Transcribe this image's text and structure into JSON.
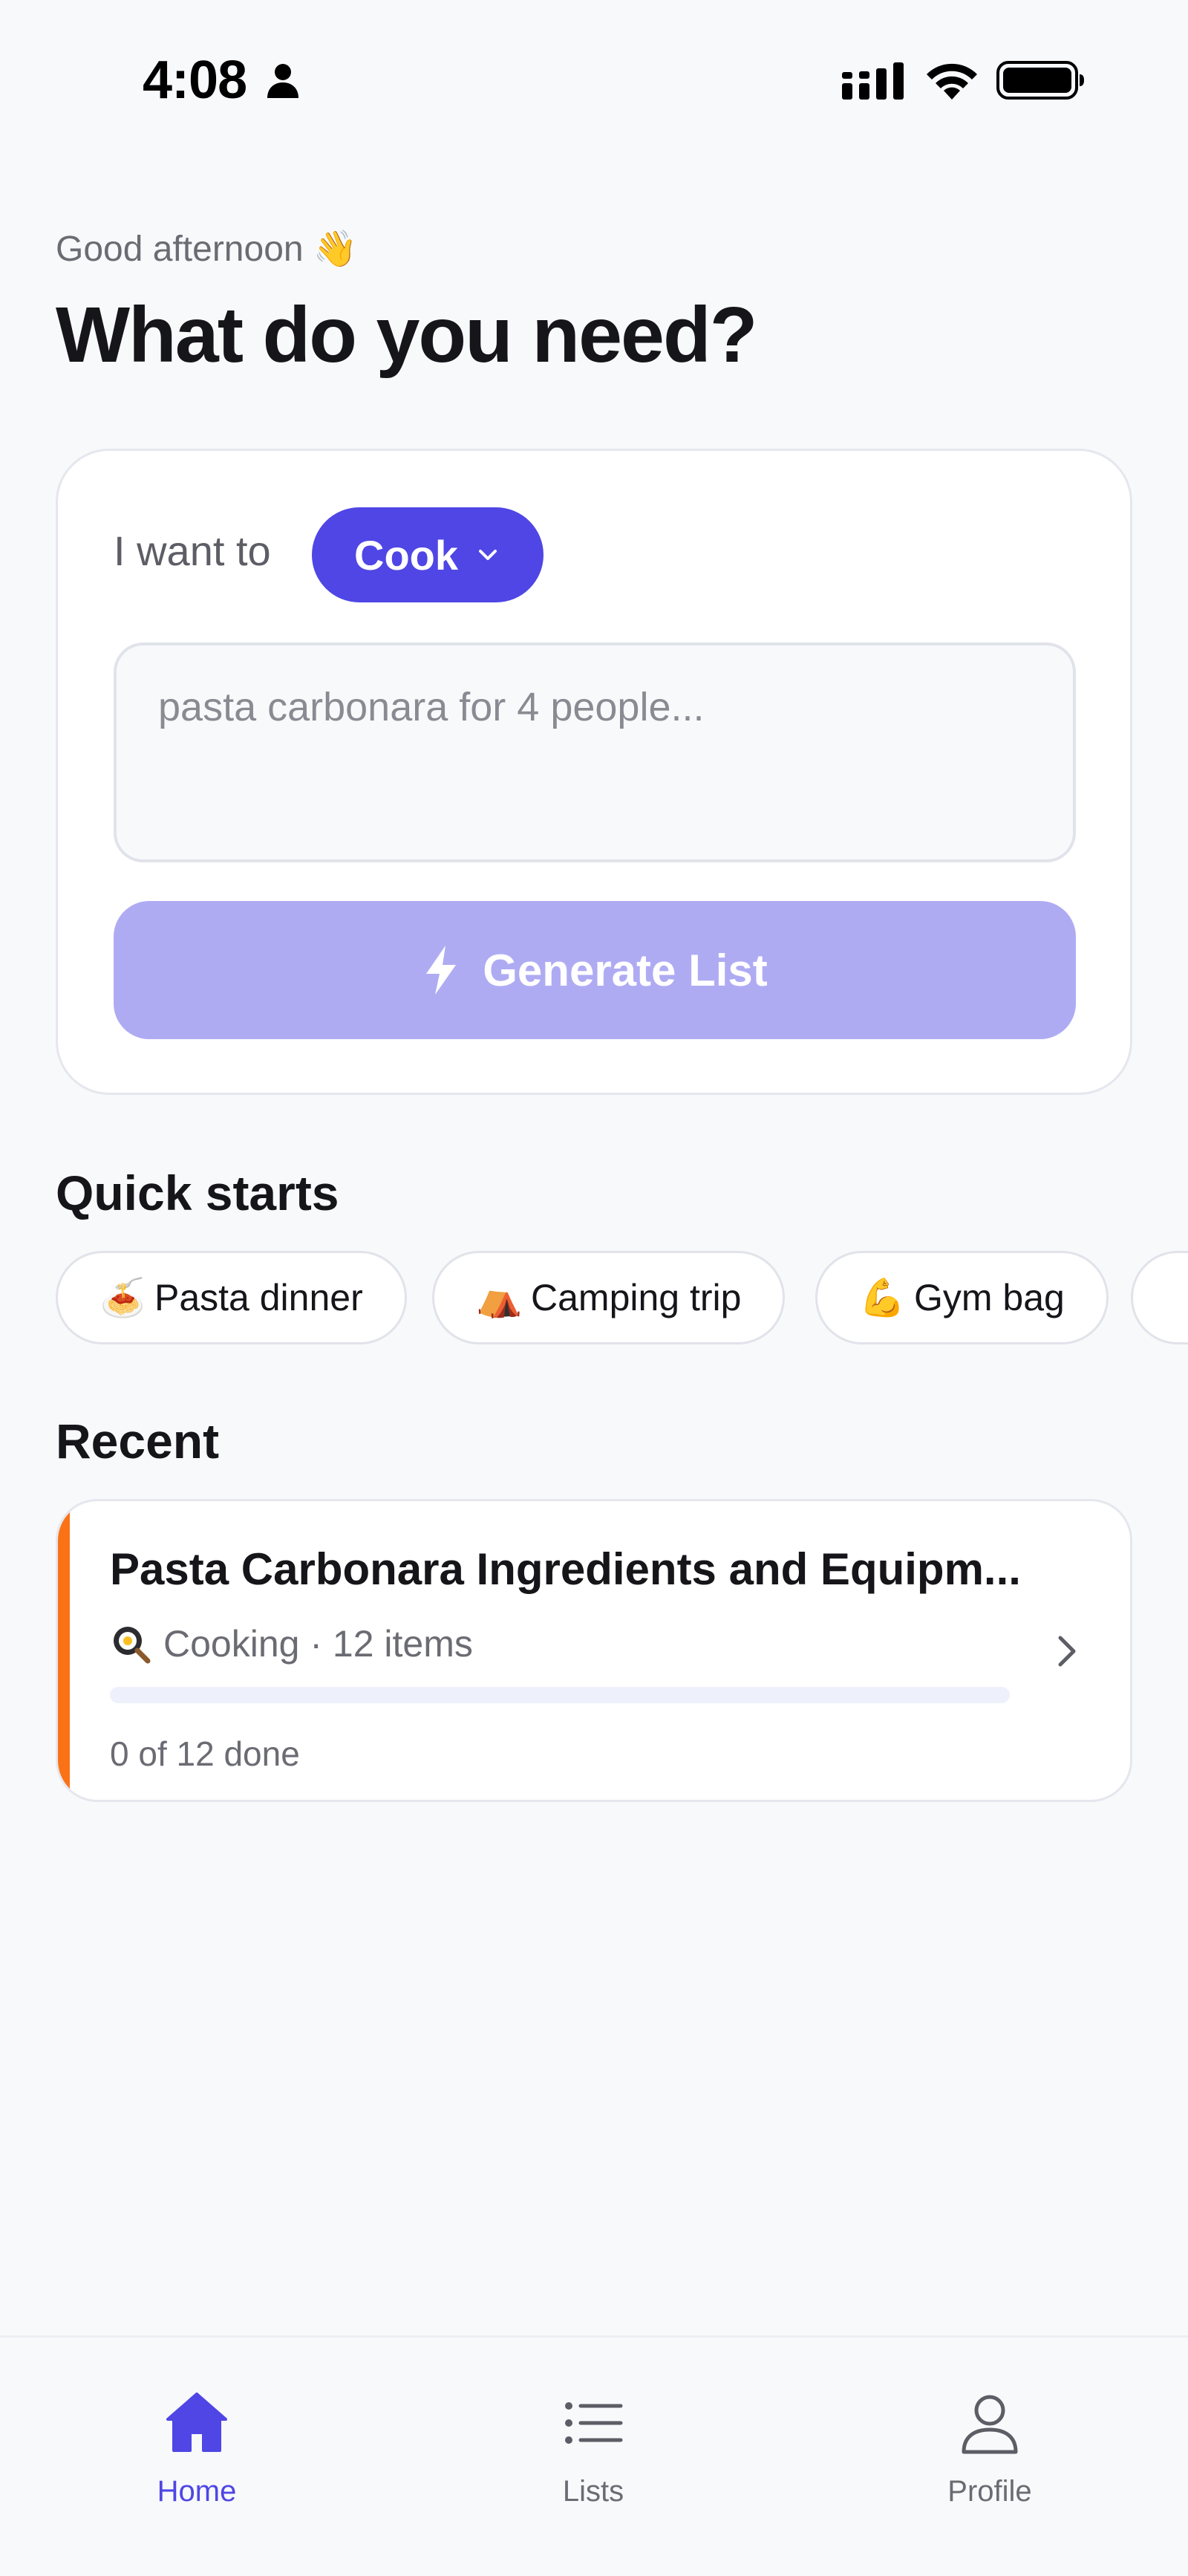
{
  "status_bar": {
    "time": "4:08"
  },
  "header": {
    "greeting": "Good afternoon 👋",
    "title": "What do you need?"
  },
  "compose": {
    "intent_label": "I want to",
    "intent_value": "Cook",
    "input_value": "",
    "input_placeholder": "pasta carbonara for 4 people...",
    "generate_label": "Generate List"
  },
  "quick_starts": {
    "title": "Quick starts",
    "items": [
      {
        "emoji": "🍝",
        "label": "Pasta dinner"
      },
      {
        "emoji": "⛺",
        "label": "Camping trip"
      },
      {
        "emoji": "💪",
        "label": "Gym bag"
      }
    ]
  },
  "recent": {
    "title": "Recent",
    "items": [
      {
        "title": "Pasta Carbonara Ingredients and Equipm...",
        "meta": "Cooking · 12 items",
        "progress_fraction": 0,
        "done_text": "0 of 12 done",
        "accent_color": "#f97316"
      }
    ]
  },
  "nav": {
    "items": [
      {
        "label": "Home",
        "icon": "home-icon",
        "active": true
      },
      {
        "label": "Lists",
        "icon": "list-icon",
        "active": false
      },
      {
        "label": "Profile",
        "icon": "profile-icon",
        "active": false
      }
    ]
  },
  "colors": {
    "accent": "#4f46e5",
    "accent_disabled": "#afabf3",
    "background": "#f8f9fb",
    "recent_accent": "#f97316"
  }
}
